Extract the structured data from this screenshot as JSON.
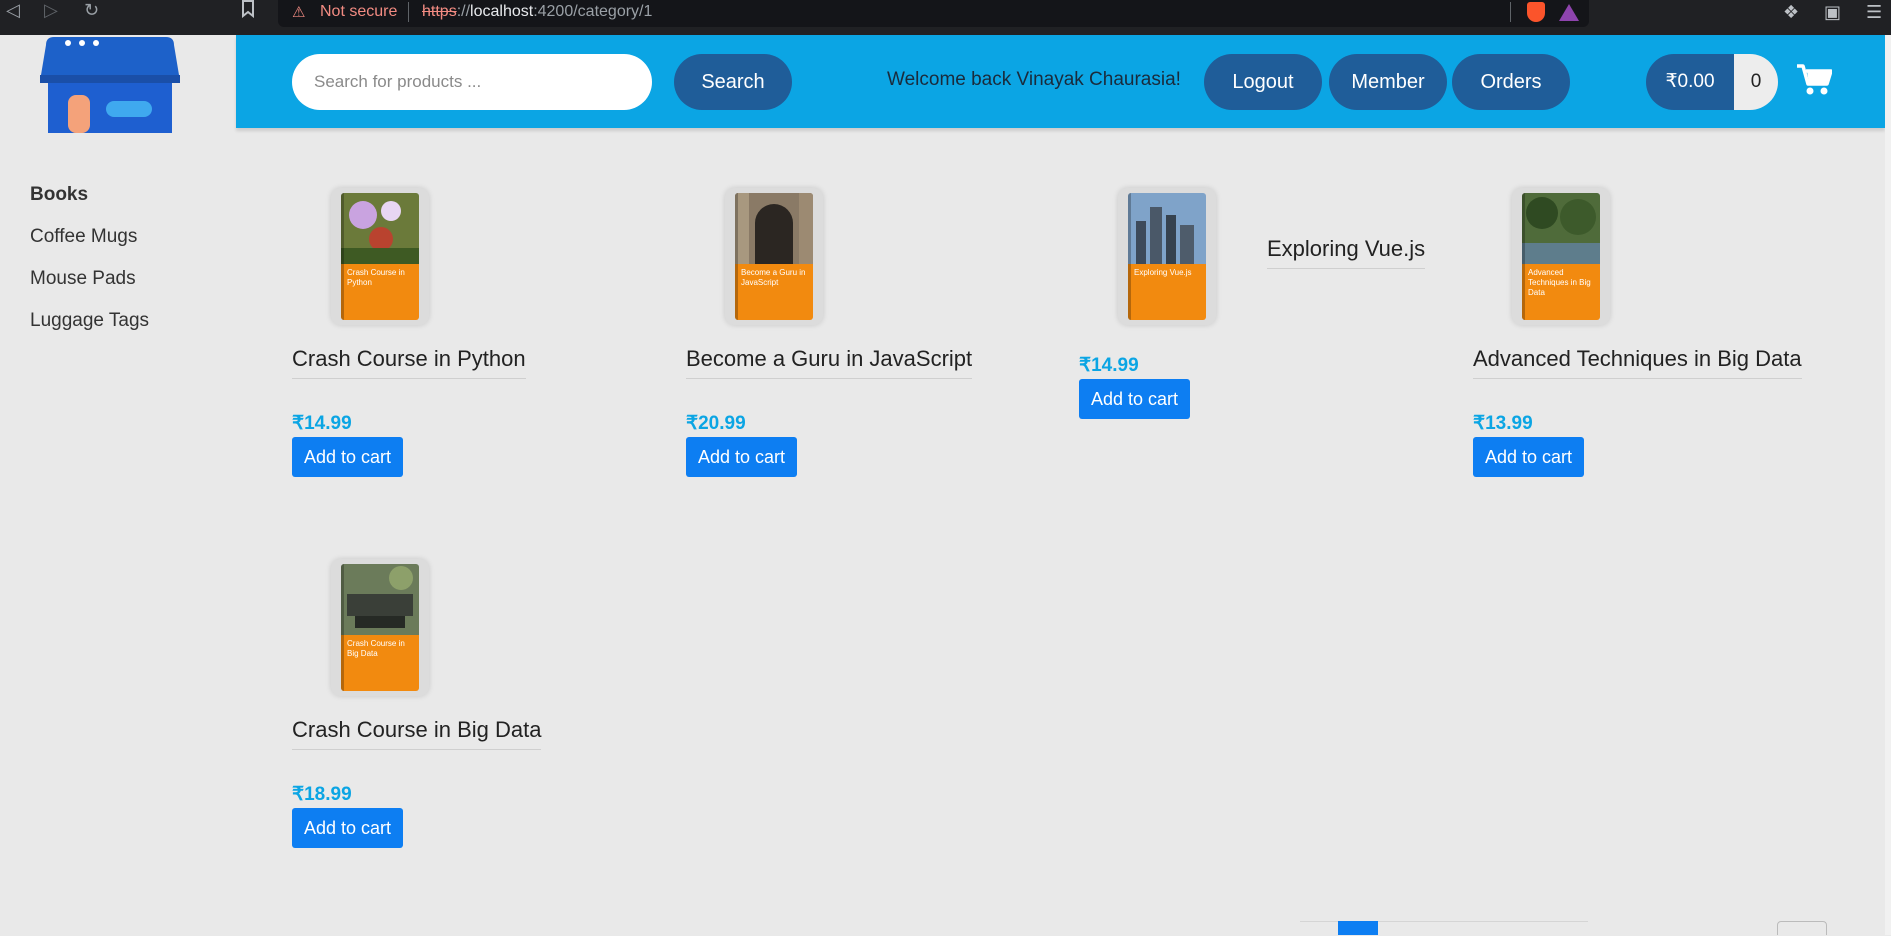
{
  "browser": {
    "security_label": "Not secure",
    "url_scheme": "https",
    "url_sep": "://",
    "url_host": "localhost",
    "url_rest": ":4200/category/1"
  },
  "search": {
    "placeholder": "Search for products ...",
    "button_label": "Search"
  },
  "header": {
    "welcome": "Welcome back Vinayak Chaurasia!",
    "logout_label": "Logout",
    "member_label": "Member",
    "orders_label": "Orders",
    "cart_total": "₹0.00",
    "cart_count": "0"
  },
  "sidebar": {
    "items": [
      {
        "label": "Books",
        "active": true
      },
      {
        "label": "Coffee Mugs",
        "active": false
      },
      {
        "label": "Mouse Pads",
        "active": false
      },
      {
        "label": "Luggage Tags",
        "active": false
      }
    ]
  },
  "products": [
    {
      "title": "Crash Course in Python",
      "cover_text": "Crash Course in Python",
      "price": "₹14.99",
      "button": "Add to cart"
    },
    {
      "title": "Become a Guru in JavaScript",
      "cover_text": "Become a Guru in JavaScript",
      "price": "₹20.99",
      "button": "Add to cart"
    },
    {
      "title": "Exploring Vue.js",
      "cover_text": "Exploring Vue.js",
      "price": "₹14.99",
      "button": "Add to cart"
    },
    {
      "title": "Advanced Techniques in Big Data",
      "cover_text": "Advanced Techniques in Big Data",
      "price": "₹13.99",
      "button": "Add to cart"
    },
    {
      "title": "Crash Course in Big Data",
      "cover_text": "Crash Course in Big Data",
      "price": "₹18.99",
      "button": "Add to cart"
    }
  ],
  "colors": {
    "header": "#0ba5e4",
    "pill": "#1f5d99",
    "add_button": "#0d7ef2",
    "price": "#0ba5e4",
    "cover_orange": "#f28a0f"
  },
  "icons": [
    "back-icon",
    "forward-icon",
    "reload-icon",
    "bookmark-icon",
    "warning-icon",
    "brave-icon",
    "rewards-icon",
    "extensions-icon",
    "wallet-icon",
    "menu-icon",
    "shopping-cart-icon",
    "store-logo"
  ]
}
